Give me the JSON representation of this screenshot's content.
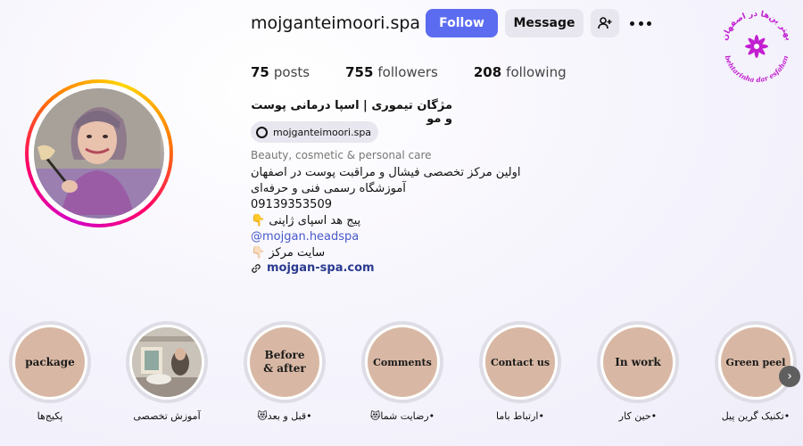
{
  "profile": {
    "username": "mojganteimoori.spa",
    "follow_label": "Follow",
    "message_label": "Message",
    "posts_count": "75",
    "posts_label": "posts",
    "followers_count": "755",
    "followers_label": "followers",
    "following_count": "208",
    "following_label": "following",
    "full_name": "مژگان تیموری | اسپا درمانی پوست و مو",
    "threads_handle": "mojganteimoori.spa",
    "category": "Beauty, cosmetic & personal care",
    "bio_lines": [
      "اولین مرکز تخصصی فیشال و مراقبت پوست در اصفهان",
      "آموزشگاه رسمی فنی و حرفه‌ای",
      "09139353509",
      "پیج هد اسپای ژاپنی 👇",
      "@mojgan.headspa",
      "سایت مرکز 👇🏻"
    ],
    "website": "mojgan-spa.com"
  },
  "logo": {
    "top_text": "بهتر ین‌ها در اصفهان",
    "bottom_text": "behtarinha dar esfahan",
    "color": "#c21fd1"
  },
  "highlights": [
    {
      "cover": "package",
      "label": "پکیج‌ها"
    },
    {
      "cover": "",
      "label": "آموزش تخصصی"
    },
    {
      "cover": "Before & after",
      "label": "•قبل و بعد😻"
    },
    {
      "cover": "Comments",
      "label": "•رضایت شما😻"
    },
    {
      "cover": "Contact us",
      "label": "•ارتباط باما"
    },
    {
      "cover": "In work",
      "label": "•حین کار"
    },
    {
      "cover": "Green peel",
      "label": "•تکنیک گرین پیل"
    }
  ],
  "icons": {
    "suggest": "add-person-icon",
    "more": "more-icon",
    "threads": "threads-icon",
    "link": "link-icon",
    "next": "chevron-right-icon"
  },
  "colors": {
    "follow_button": "#5b6cf0",
    "link": "#4758c9",
    "highlight_cover": "#d8b8a4"
  }
}
